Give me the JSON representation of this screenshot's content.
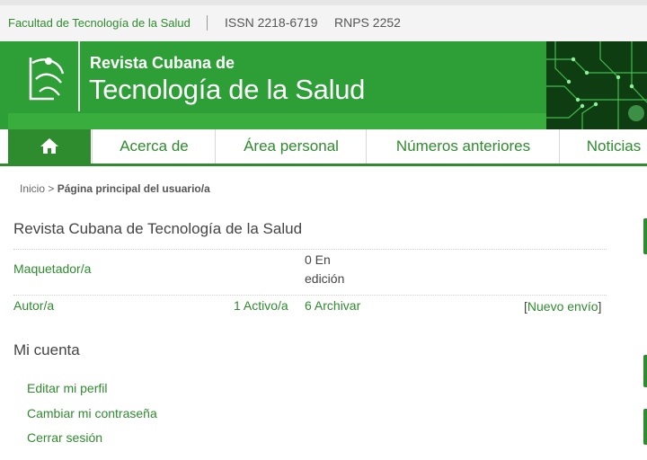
{
  "topbar": {
    "faculty": "Facultad de Tecnología de la Salud",
    "issn": "ISSN 2218-6719",
    "rnps": "RNPS 2252"
  },
  "banner": {
    "title_small": "Revista Cubana de",
    "title_big": "Tecnología de la Salud"
  },
  "nav": {
    "home_icon": "home-icon",
    "items": [
      "Acerca de",
      "Área personal",
      "Números anteriores",
      "Noticias"
    ]
  },
  "breadcrumb": {
    "home": "Inicio",
    "separator": ">",
    "current": "Página principal del usuario/a"
  },
  "journal": {
    "name": "Revista Cubana de Tecnología de la Salud",
    "roles": [
      {
        "role": "Maquetador/a",
        "status": "0 En edición"
      },
      {
        "role": "Autor/a",
        "active": "1 Activo/a",
        "archive": "6 Archivar",
        "new_open": "[",
        "new_link": "Nuevo envío",
        "new_close": "]"
      }
    ]
  },
  "account": {
    "title": "Mi cuenta",
    "links": [
      "Editar mi perfil",
      "Cambiar mi contraseña",
      "Cerrar sesión"
    ]
  },
  "colors": {
    "brand": "#2e8b2e",
    "banner": "#2e9e36"
  }
}
